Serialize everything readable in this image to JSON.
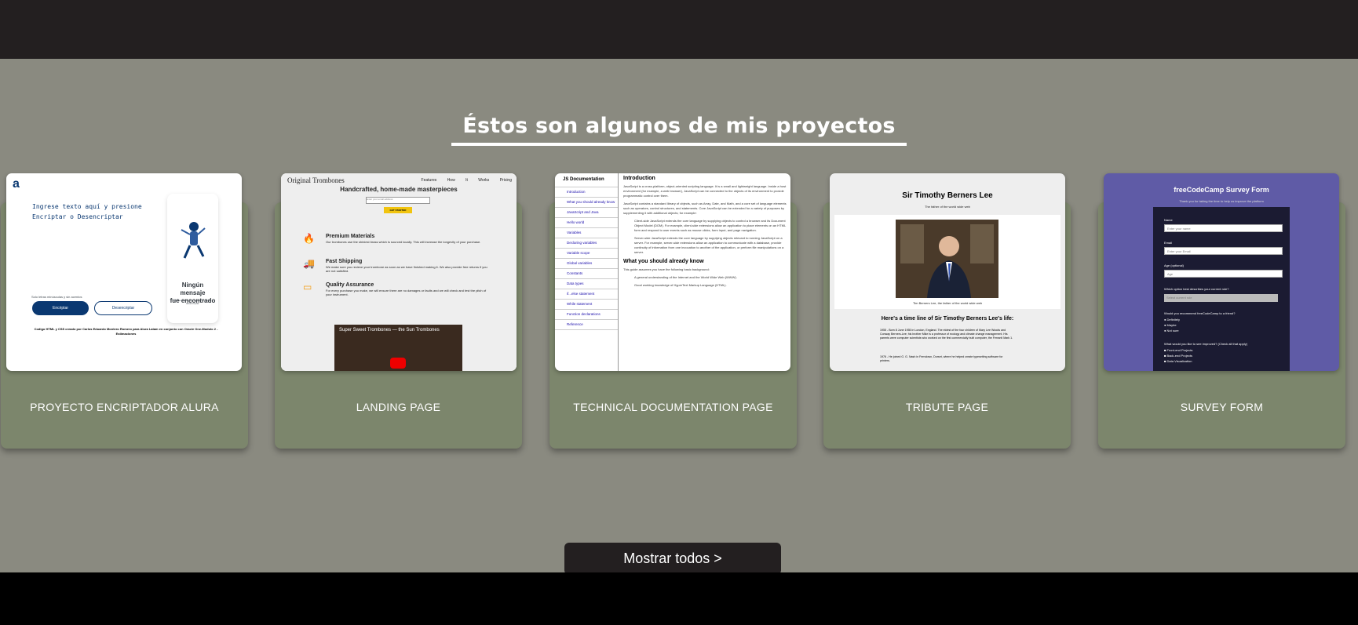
{
  "section": {
    "heading": "Éstos son algunos de mis proyectos",
    "show_all_label": "Mostrar todos >"
  },
  "projects": [
    {
      "label": "PROYECTO ENCRIPTADOR ALURA",
      "preview": {
        "logo": "a",
        "input_placeholder_1": "Ingrese texto aquí y presione",
        "input_placeholder_2": "Encriptar o Desencriptar",
        "result_heading_1": "Ningún mensaje",
        "result_heading_2": "fue encontrado",
        "result_text": "Ingresa el texto que deseas encriptar o desencriptar.",
        "info": "Solo letras minúsculas y sin acentos",
        "encrypt_label": "Encriptar",
        "decrypt_label": "Desencriptar",
        "footer": "Codigo HTML y CSS creado por Carlos Eduardo Montero Romero para Alura Latam en conjunto con Oracle One-Modulo 2 - Estimaciones"
      }
    },
    {
      "label": "LANDING PAGE",
      "preview": {
        "logo": "Original Trombones",
        "nav": [
          "Features",
          "How It Works",
          "Pricing"
        ],
        "headline": "Handcrafted, home-made masterpieces",
        "email_placeholder": "Enter your email address",
        "button": "GET STARTED",
        "features": [
          {
            "title": "Premium Materials",
            "text": "Our trombones use the shiniest brass which is sourced locally. This will increase the longevity of your purchase."
          },
          {
            "title": "Fast Shipping",
            "text": "We make sure you recieve your trombone as soon as we have finished making it. We also provide free returns if you are not satisfied."
          },
          {
            "title": "Quality Assurance",
            "text": "For every purchase you make, we will ensure there are no damages or faults and we will check and test the pitch of your instrument."
          }
        ],
        "video_title": "Super Sweet Trombones — the Sun Trombones"
      }
    },
    {
      "label": "TECHNICAL DOCUMENTATION PAGE",
      "preview": {
        "nav_title": "JS Documentation",
        "nav_items": [
          "Introduction",
          "What you should already know",
          "JavaScript and Java",
          "Hello world",
          "Variables",
          "Declaring variables",
          "Variable scope",
          "Global variables",
          "Constants",
          "Data types",
          "if...else statement",
          "While statement",
          "Function declarations",
          "Reference"
        ],
        "section_title": "Introduction",
        "p1": "JavaScript is a cross-platform, object-oriented scripting language. It is a small and lightweight language. Inside a host environment (for example, a web browser), JavaScript can be connected to the objects of its environment to provide programmatic control over them.",
        "p2": "JavaScript contains a standard library of objects, such as Array, Date, and Math, and a core set of language elements such as operators, control structures, and statements. Core JavaScript can be extended for a variety of purposes by supplementing it with additional objects; for example:",
        "p3": "Client-side JavaScript extends the core language by supplying objects to control a browser and its Document Object Model (DOM). For example, client-side extensions allow an application to place elements on an HTML form and respond to user events such as mouse clicks, form input, and page navigation.",
        "p4": "Server-side JavaScript extends the core language by supplying objects relevant to running JavaScript on a server. For example, server-side extensions allow an application to communicate with a database, provide continuity of information from one invocation to another of the application, or perform file manipulations on a server.",
        "section2_title": "What you should already know",
        "p5": "This guide assumes you have the following basic background:",
        "p6": "A general understanding of the Internet and the World Wide Web (WWW).",
        "p7": "Good working knowledge of HyperText Markup Language (HTML)."
      }
    },
    {
      "label": "TRIBUTE PAGE",
      "preview": {
        "title": "Sir Timothy Berners Lee",
        "subtitle": "The father of the world wide web",
        "caption": "Tim Berners Lee, the father of the world wide web",
        "timeline_title": "Here's a time line of Sir Timothy Berners Lee's life:",
        "item1": "1955 - Born 8 June 1955 in London, England. The eldest of the four children of Mary Lee Woods and Conway Berners-Lee; his brother Mike is a professor of ecology and climate change management. His parents were computer scientists who worked on the first commercially built computer, the Ferranti Mark 1.",
        "item2": "1976 - He joined G. G. Nash in Ferndown, Dorset, where he helped create typesetting software for printers."
      }
    },
    {
      "label": "SURVEY FORM",
      "preview": {
        "title": "freeCodeCamp Survey Form",
        "subtitle": "Thank you for taking the time to help us improve the platform",
        "name_label": "Name",
        "name_placeholder": "Enter your name",
        "email_label": "Email",
        "email_placeholder": "Enter your Email",
        "age_label": "Age (optional)",
        "age_placeholder": "Age",
        "role_label": "Which option best describes your current role?",
        "role_placeholder": "Select current role",
        "recommend_label": "Would you recommend freeCodeCamp to a friend?",
        "options": [
          "Definitely",
          "Maybe",
          "Not sure"
        ],
        "improve_label": "What would you like to see improved?",
        "improve_hint": "(Check all that apply)",
        "checks": [
          "Front-end Projects",
          "Back-end Projects",
          "Data Visualization"
        ]
      }
    }
  ]
}
